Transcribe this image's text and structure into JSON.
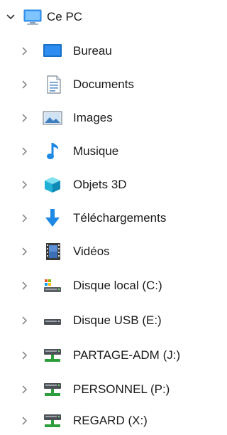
{
  "tree": {
    "root": {
      "label": "Ce PC",
      "icon": "computer-icon",
      "expanded": true
    },
    "children": [
      {
        "label": "Bureau",
        "icon": "desktop-icon"
      },
      {
        "label": "Documents",
        "icon": "documents-icon"
      },
      {
        "label": "Images",
        "icon": "images-icon"
      },
      {
        "label": "Musique",
        "icon": "music-icon"
      },
      {
        "label": "Objets 3D",
        "icon": "objects-3d-icon"
      },
      {
        "label": "Téléchargements",
        "icon": "downloads-icon"
      },
      {
        "label": "Vidéos",
        "icon": "videos-icon"
      },
      {
        "label": "Disque local (C:)",
        "icon": "local-disk-icon"
      },
      {
        "label": "Disque USB (E:)",
        "icon": "usb-drive-icon"
      },
      {
        "label": "PARTAGE-ADM (J:)",
        "icon": "network-drive-icon"
      },
      {
        "label": "PERSONNEL (P:)",
        "icon": "network-drive-icon"
      },
      {
        "label": "REGARD (X:)",
        "icon": "network-drive-icon"
      }
    ]
  },
  "colors": {
    "accent": "#1e88e5",
    "network_green": "#2e9e3c"
  }
}
